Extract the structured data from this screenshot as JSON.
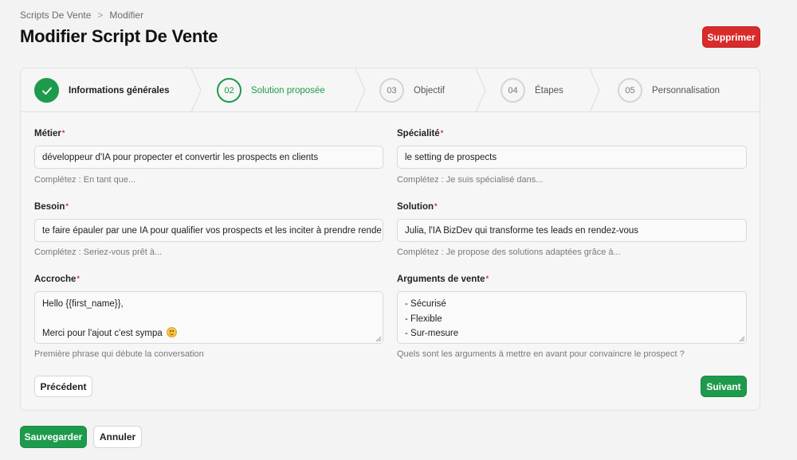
{
  "breadcrumb": {
    "parent": "Scripts De Vente",
    "separator": ">",
    "current": "Modifier"
  },
  "page": {
    "title": "Modifier Script De Vente",
    "delete_label": "Supprimer"
  },
  "steps": [
    {
      "number": "",
      "label": "Informations générales",
      "state": "done"
    },
    {
      "number": "02",
      "label": "Solution proposée",
      "state": "active"
    },
    {
      "number": "03",
      "label": "Objectif",
      "state": "upcoming"
    },
    {
      "number": "04",
      "label": "Étapes",
      "state": "upcoming"
    },
    {
      "number": "05",
      "label": "Personnalisation",
      "state": "upcoming"
    }
  ],
  "form": {
    "metier": {
      "label": "Métier",
      "required_mark": "*",
      "value": "développeur d'IA pour propecter et convertir les prospects en clients",
      "hint": "Complétez : En tant que..."
    },
    "specialite": {
      "label": "Spécialité",
      "required_mark": "*",
      "value": "le setting de prospects",
      "hint": "Complétez : Je suis spécialisé dans..."
    },
    "besoin": {
      "label": "Besoin",
      "required_mark": "*",
      "value": "te faire épauler par une IA pour qualifier vos prospects et les inciter à prendre rende",
      "hint": "Complétez : Seriez-vous prêt à..."
    },
    "solution": {
      "label": "Solution",
      "required_mark": "*",
      "value": "Julia, l'IA BizDev qui transforme tes leads en rendez-vous",
      "hint": "Complétez : Je propose des solutions adaptées grâce à..."
    },
    "accroche": {
      "label": "Accroche",
      "required_mark": "*",
      "lines": [
        "Hello {{first_name}},",
        "",
        "Merci pour l'ajout c'est sympa"
      ],
      "hint": "Première phrase qui débute la conversation"
    },
    "arguments": {
      "label": "Arguments de vente",
      "required_mark": "*",
      "lines": [
        "- Sécurisé",
        "- Flexible",
        "- Sur-mesure"
      ],
      "hint": "Quels sont les arguments à mettre en avant pour convaincre le prospect ?"
    }
  },
  "nav": {
    "previous_label": "Précédent",
    "next_label": "Suivant"
  },
  "footer": {
    "save_label": "Sauvegarder",
    "cancel_label": "Annuler"
  },
  "colors": {
    "primary_green": "#1e9a4c",
    "danger_red": "#d92b2b"
  }
}
